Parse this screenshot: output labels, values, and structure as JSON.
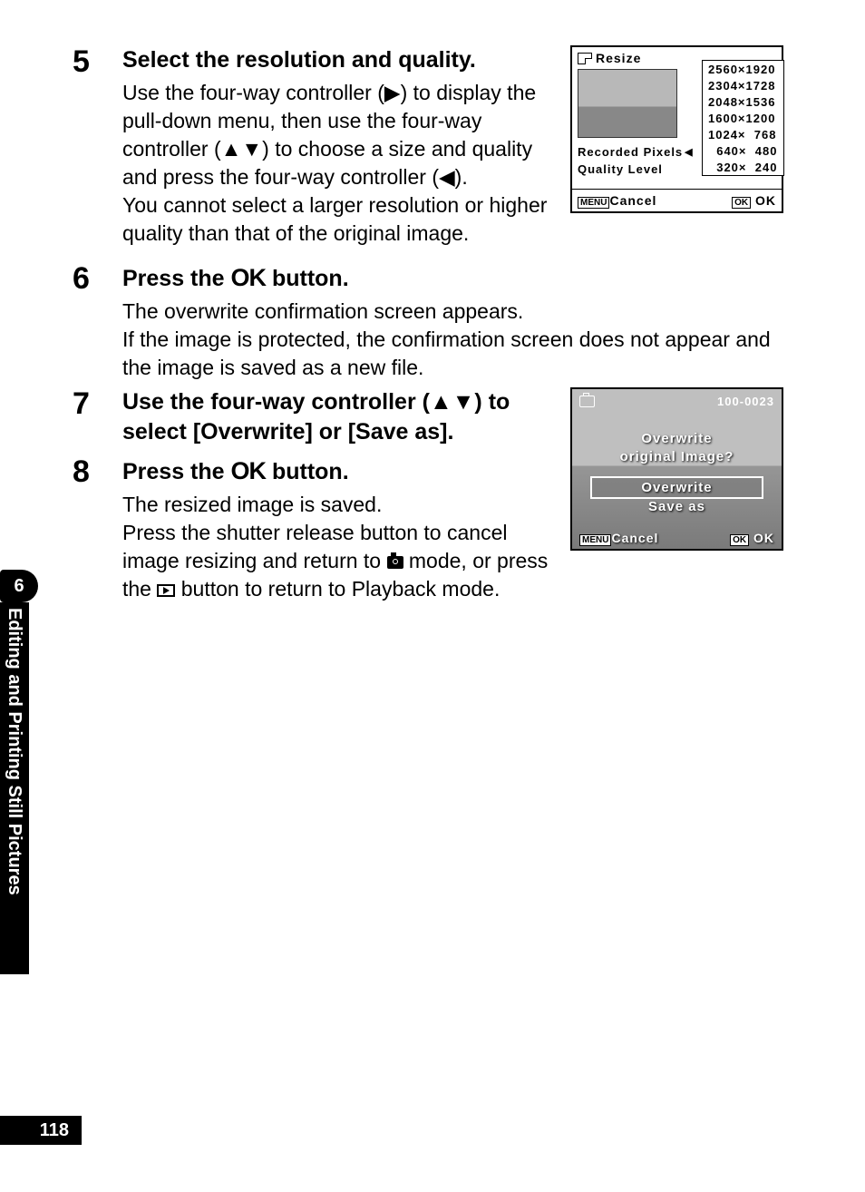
{
  "steps": {
    "s5": {
      "num": "5",
      "title": "Select the resolution and quality.",
      "p1": "Use the four-way controller (▶) to display the pull-down menu, then use the four-way controller (▲▼) to choose a size and quality and press the four-way controller (◀).",
      "p2": "You cannot select a larger resolution or higher quality than that of the original image."
    },
    "s6": {
      "num": "6",
      "title_a": "Press the ",
      "title_ok": "OK",
      "title_b": " button.",
      "p1": "The overwrite confirmation screen appears.",
      "p2": "If the image is protected, the confirmation screen does not appear and the image is saved as a new file."
    },
    "s7": {
      "num": "7",
      "title": "Use the four-way controller (▲▼) to select [Overwrite] or [Save as]."
    },
    "s8": {
      "num": "8",
      "title_a": "Press the ",
      "title_ok": "OK",
      "title_b": " button.",
      "p1": "The resized image is saved.",
      "p2a": "Press the shutter release button to cancel image resizing and return to ",
      "p2b": " mode, or press the ",
      "p2c": " button to return to Playback mode."
    }
  },
  "lcd1": {
    "title": "Resize",
    "row1": "Recorded Pixels",
    "row2": "Quality Level",
    "options": [
      "2560×1920",
      "2304×1728",
      "2048×1536",
      "1600×1200",
      "1024×  768",
      "  640×  480",
      "  320×  240"
    ],
    "menu": "MENU",
    "cancel": "Cancel",
    "ok_box": "OK",
    "ok": "OK"
  },
  "lcd2": {
    "file_no": "100-0023",
    "msg1": "Overwrite",
    "msg2": "original Image?",
    "opt1": "Overwrite",
    "opt2": "Save as",
    "menu": "MENU",
    "cancel": "Cancel",
    "ok_box": "OK",
    "ok": "OK"
  },
  "sidetab": {
    "chapter": "6",
    "label": "Editing and Printing Still Pictures"
  },
  "page_number": "118"
}
